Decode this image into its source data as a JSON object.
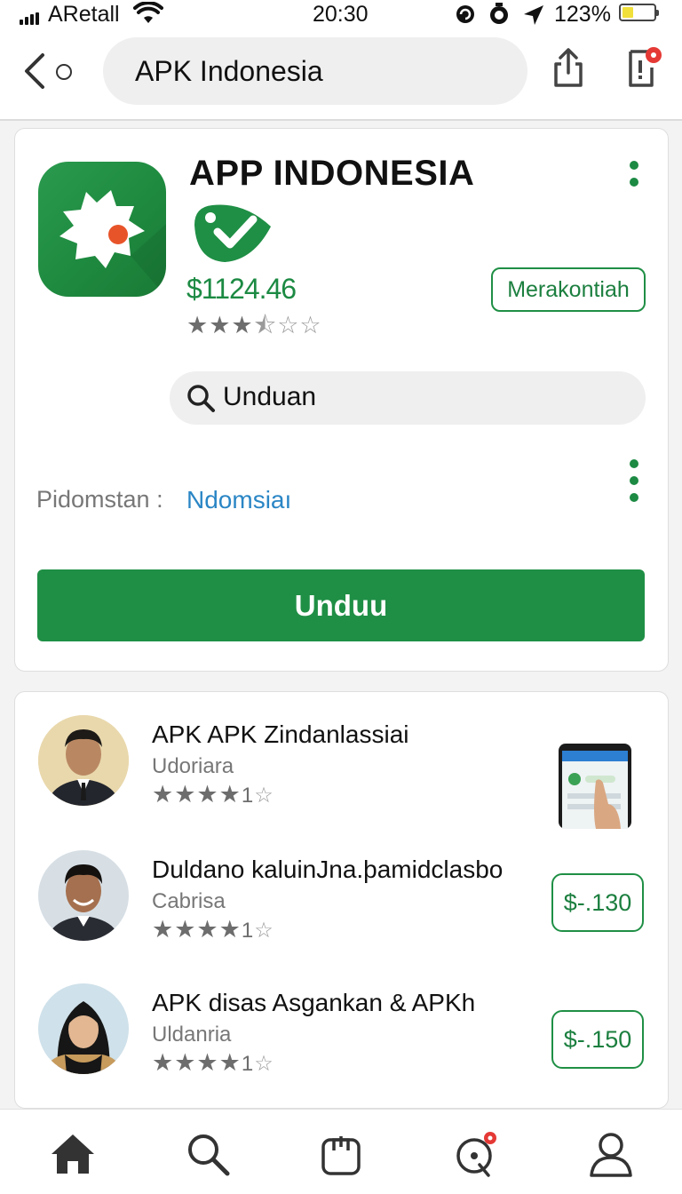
{
  "status_bar": {
    "carrier": "ARetall",
    "time": "20:30",
    "battery": "123%",
    "icons": [
      "signal-icon",
      "wifi-icon",
      "alarm-icon",
      "location-icon",
      "battery-icon"
    ]
  },
  "nav": {
    "url": "APK Indonesia",
    "icons": [
      "back-icon",
      "tabs-icon",
      "share-icon",
      "notification-icon"
    ]
  },
  "app": {
    "title": "APP INDONESIA",
    "price": "$1124.46",
    "rating": 3.5,
    "tag_button": "Merakontiah",
    "search_text": "Unduan",
    "publisher_label": "Pidomstan :",
    "publisher_value": "Ndomsiaı",
    "download_button": "Unduu"
  },
  "list": {
    "items": [
      {
        "name": "APK APK Zindanlassiai",
        "sub": "Udoriara",
        "rating_count": "1",
        "stars": 4
      },
      {
        "name": "Duldano kaluinJna.þamidclasbo",
        "sub": "Cabrisa",
        "rating_count": "1",
        "stars": 4,
        "price": "$-.130"
      },
      {
        "name": "APK disas Asgankan  & APKh",
        "sub": "Uldanria",
        "rating_count": "1",
        "stars": 4,
        "price": "$-.150"
      }
    ]
  },
  "bottom_nav": [
    "home-icon",
    "search-icon",
    "bag-icon",
    "notifications-icon",
    "profile-icon"
  ],
  "colors": {
    "accent": "#1f8f45",
    "link": "#2a86c5",
    "badge": "#e53935"
  }
}
